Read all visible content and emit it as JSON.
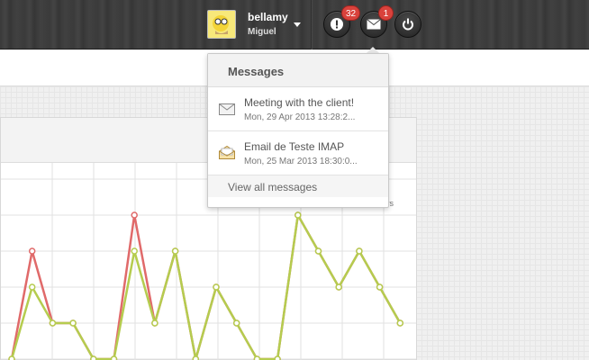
{
  "header": {
    "user_name": "bellamy",
    "user_sub": "Miguel",
    "alerts_count": "32",
    "messages_count": "1",
    "alert_icon": "exclamation-icon",
    "messages_icon": "envelope-icon",
    "power_icon": "power-icon"
  },
  "dropdown": {
    "title": "Messages",
    "items": [
      {
        "title": "Meeting with the client!",
        "date": "Mon, 29 Apr 2013 13:28:2...",
        "icon": "envelope-closed-icon"
      },
      {
        "title": "Email de Teste IMAP",
        "date": "Mon, 25 Mar 2013 18:30:0...",
        "icon": "envelope-open-icon"
      }
    ],
    "footer": "View all messages"
  },
  "chart": {
    "legend_fragment": "vs"
  },
  "colors": {
    "accent_green": "#b5cc4f",
    "accent_red": "#e06a6a",
    "badge_red": "#d9423c"
  },
  "chart_data": {
    "type": "line",
    "x": [
      0,
      1,
      2,
      3,
      4,
      5,
      6,
      7,
      8,
      9,
      10,
      11,
      12,
      13,
      14,
      15,
      16,
      17,
      18,
      19
    ],
    "series": [
      {
        "values": [
          0,
          3,
          1,
          1,
          0,
          0,
          4,
          1,
          3,
          0,
          2,
          1,
          0,
          0,
          4,
          3,
          2,
          3,
          2,
          1
        ]
      },
      {
        "values": [
          0,
          2,
          1,
          1,
          0,
          0,
          3,
          1,
          3,
          0,
          2,
          1,
          0,
          0,
          4,
          3,
          2,
          3,
          2,
          1
        ]
      }
    ],
    "grid": true
  }
}
